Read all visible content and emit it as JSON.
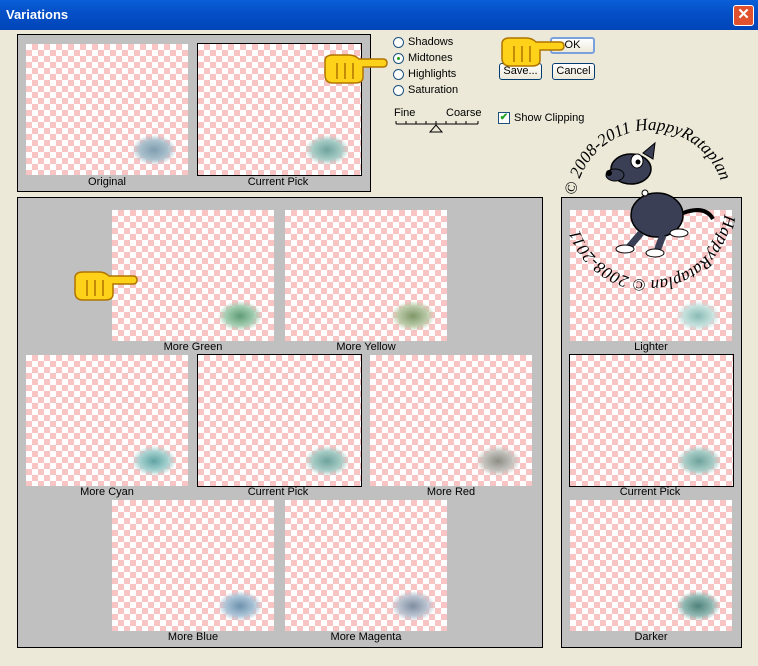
{
  "window": {
    "title": "Variations",
    "close_glyph": "✕"
  },
  "tones": {
    "options": [
      {
        "label": "Shadows",
        "selected": false
      },
      {
        "label": "Midtones",
        "selected": true
      },
      {
        "label": "Highlights",
        "selected": false
      },
      {
        "label": "Saturation",
        "selected": false
      }
    ],
    "fine_label": "Fine",
    "coarse_label": "Coarse"
  },
  "buttons": {
    "ok": "OK",
    "save": "Save...",
    "cancel": "Cancel"
  },
  "show_clipping": {
    "label": "Show Clipping",
    "checked": true
  },
  "top_thumbs": {
    "original": "Original",
    "current_pick": "Current Pick"
  },
  "color_thumbs": {
    "more_green": "More Green",
    "more_yellow": "More Yellow",
    "more_cyan": "More Cyan",
    "current_pick": "Current Pick",
    "more_red": "More Red",
    "more_blue": "More Blue",
    "more_magenta": "More Magenta"
  },
  "light_thumbs": {
    "lighter": "Lighter",
    "current_pick": "Current Pick",
    "darker": "Darker"
  },
  "watermark": {
    "text_top": "© 2008-2011 HappyRataplan",
    "text_bottom": "HappyRataplan © 2008-2011"
  },
  "colors": {
    "title_bar": "#0550c8",
    "checker": "#f8c4c4",
    "panel": "#c0c0c0",
    "dialog": "#ece9d8"
  }
}
